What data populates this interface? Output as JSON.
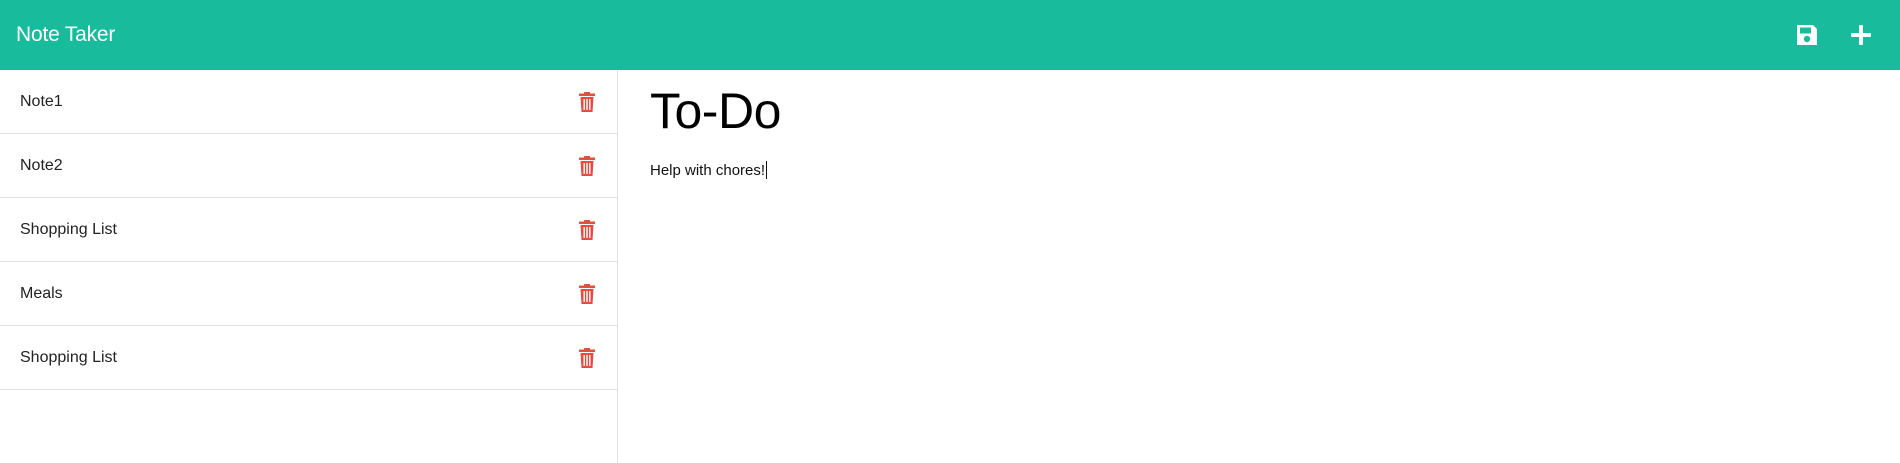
{
  "app": {
    "title": "Note Taker",
    "accent_color": "#18bc9c",
    "delete_color": "#e74c3c"
  },
  "toolbar": {
    "save_icon": "save-icon",
    "new_icon": "plus-icon"
  },
  "sidebar": {
    "items": [
      {
        "label": "Note1"
      },
      {
        "label": "Note2"
      },
      {
        "label": "Shopping List"
      },
      {
        "label": "Meals"
      },
      {
        "label": "Shopping List"
      }
    ],
    "delete_icon": "trash-icon"
  },
  "note": {
    "title": "To-Do",
    "body": "Help with chores!"
  }
}
